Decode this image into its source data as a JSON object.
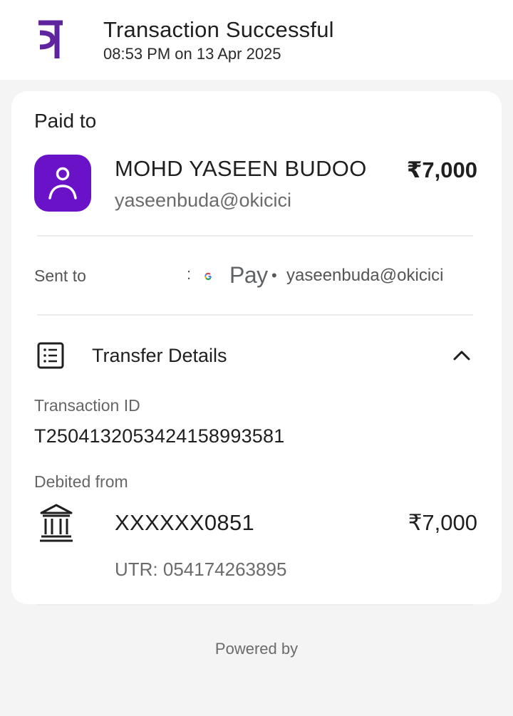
{
  "header": {
    "title": "Transaction Successful",
    "datetime": "08:53 PM on 13 Apr 2025",
    "brand_color": "#5f259f"
  },
  "paid_section": {
    "label": "Paid to",
    "payee_name": "MOHD YASEEN BUDOO",
    "payee_upi": "yaseenbuda@okicici",
    "amount": "₹7,000",
    "avatar_color": "#6a12c8"
  },
  "sent_to": {
    "label": "Sent to",
    "separator": ":",
    "app_name": "Pay",
    "bullet": "•",
    "upi": "yaseenbuda@okicici"
  },
  "transfer_details": {
    "label": "Transfer Details",
    "transaction_id_label": "Transaction ID",
    "transaction_id": "T2504132053424158993581",
    "debited_from_label": "Debited from",
    "account": "XXXXXX0851",
    "amount": "₹7,000",
    "utr": "UTR: 054174263895"
  },
  "footer": {
    "powered_by": "Powered by"
  }
}
